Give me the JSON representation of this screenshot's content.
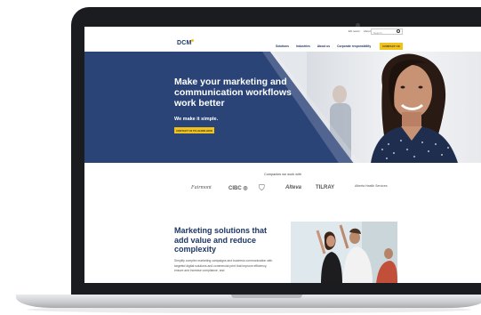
{
  "top_links": [
    "EN newsr",
    "About",
    "Ops support",
    "FR"
  ],
  "search": {
    "placeholder": "Search"
  },
  "logo": {
    "text": "DCM"
  },
  "nav": {
    "items": [
      "Solutions",
      "Industries",
      "About us",
      "Corporate responsibility"
    ],
    "contact_label": "CONTACT US"
  },
  "hero": {
    "title": "Make your marketing and communication workflows work better",
    "subtitle": "We make it simple.",
    "cta_label": "CONTACT US TO LEARN HOW"
  },
  "partners": {
    "title": "Companies we work with",
    "logos": [
      "Fairmont",
      "CIBC ◎",
      "⛉",
      "Alteva",
      "TILRAY",
      "Alberta Health Services"
    ]
  },
  "solutions": {
    "title": "Marketing solutions that add value and reduce complexity",
    "body": "Simplify complex marketing campaigns and business communication with targeted digital solutions and commercial print that improve efficiency, ensure and increase compliance, and"
  },
  "colors": {
    "navy": "#2b4478",
    "brand": "#1e3766",
    "accent": "#f2c21a"
  }
}
